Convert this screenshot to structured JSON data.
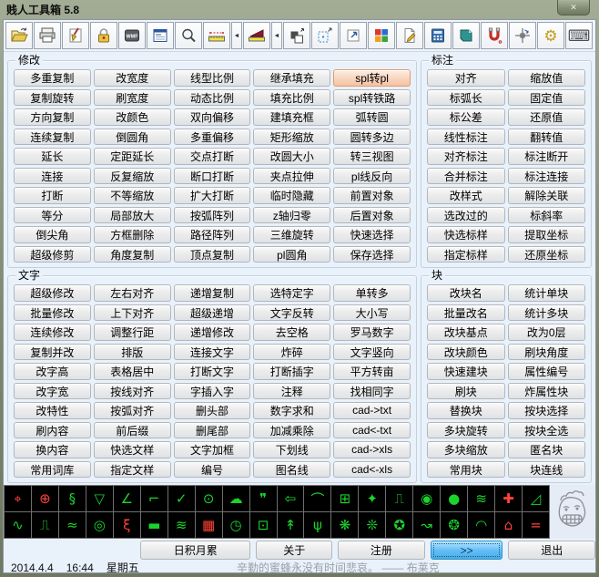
{
  "window": {
    "title": "贱人工具箱 5.8",
    "close_glyph": "✕"
  },
  "toolbar": {
    "wmf_label": "WMF",
    "dropdown_glyph": "◄",
    "items": [
      "open-file",
      "print",
      "purge",
      "lock",
      "wmf-export",
      "form-table",
      "zoom-view",
      "measure",
      "area-fill",
      "copy-objects",
      "stretch-selection",
      "export-window",
      "color-palette",
      "edit-document",
      "calculator",
      "notebook",
      "magnet-osnap",
      "rotate-point",
      "settings-gears",
      "keyboard-shortcuts"
    ]
  },
  "sections": {
    "modify": {
      "title": "修改",
      "highlight": "spl转pl",
      "columns": [
        [
          "多重复制",
          "复制旋转",
          "方向复制",
          "连续复制",
          "延长",
          "连接",
          "打断",
          "等分",
          "倒尖角",
          "超级修剪"
        ],
        [
          "改宽度",
          "刷宽度",
          "改颜色",
          "倒圆角",
          "定距延长",
          "反复缩放",
          "不等缩放",
          "局部放大",
          "方框删除",
          "角度复制"
        ],
        [
          "线型比例",
          "动态比例",
          "双向偏移",
          "多重偏移",
          "交点打断",
          "断口打断",
          "扩大打断",
          "按弧阵列",
          "路径阵列",
          "顶点复制"
        ],
        [
          "继承填充",
          "填充比例",
          "建填充框",
          "矩形缩放",
          "改圆大小",
          "夹点拉伸",
          "临时隐藏",
          "z轴归零",
          "三维旋转",
          "pl圆角"
        ],
        [
          "spl转pl",
          "spl转铁路",
          "弧转圆",
          "圆转多边",
          "转三视图",
          "pl线反向",
          "前置对象",
          "后置对象",
          "快速选择",
          "保存选择"
        ]
      ]
    },
    "dimension": {
      "title": "标注",
      "columns": [
        [
          "对齐",
          "标弧长",
          "标公差",
          "线性标注",
          "对齐标注",
          "合并标注",
          "改样式",
          "选改过的",
          "快选标样",
          "指定标样"
        ],
        [
          "缩放值",
          "固定值",
          "还原值",
          "翻转值",
          "标注断开",
          "标注连接",
          "解除关联",
          "标斜率",
          "提取坐标",
          "还原坐标"
        ]
      ]
    },
    "text": {
      "title": "文字",
      "columns": [
        [
          "超级修改",
          "批量修改",
          "连续修改",
          "复制并改",
          "改字高",
          "改字宽",
          "改特性",
          "刷内容",
          "换内容",
          "常用词库"
        ],
        [
          "左右对齐",
          "上下对齐",
          "调整行距",
          "排版",
          "表格居中",
          "按线对齐",
          "按弧对齐",
          "前后缀",
          "快选文样",
          "指定文样"
        ],
        [
          "递增复制",
          "超级递增",
          "递增修改",
          "连接文字",
          "打断文字",
          "字插入字",
          "删头部",
          "删尾部",
          "文字加框",
          "编号"
        ],
        [
          "选特定字",
          "文字反转",
          "去空格",
          "炸碎",
          "打断插字",
          "注释",
          "数字求和",
          "加减乘除",
          "下划线",
          "图名线"
        ],
        [
          "单转多",
          "大小写",
          "罗马数字",
          "文字竖向",
          "平方转亩",
          "找相同字",
          "cad->txt",
          "cad<-txt",
          "cad->xls",
          "cad<-xls"
        ]
      ]
    },
    "block": {
      "title": "块",
      "columns": [
        [
          "改块名",
          "批量改名",
          "改块基点",
          "改块颜色",
          "快速建块",
          "刷块",
          "替换块",
          "多块旋转",
          "多块缩放",
          "常用块"
        ],
        [
          "统计单块",
          "统计多块",
          "改为0层",
          "刷块角度",
          "属性编号",
          "炸属性块",
          "按块选择",
          "按块全选",
          "匿名块",
          "块连线"
        ]
      ]
    }
  },
  "icon_grid": {
    "rows": [
      [
        {
          "n": "point-cross-square",
          "g": "⌖",
          "c": "r"
        },
        {
          "n": "point-cross-circle",
          "g": "⊕",
          "c": "r"
        },
        {
          "n": "section-symbol",
          "g": "§",
          "c": "g"
        },
        {
          "n": "roughness-symbol",
          "g": "▽",
          "c": "g"
        },
        {
          "n": "slope-symbol",
          "g": "∠",
          "c": "g"
        },
        {
          "n": "corner-dimension",
          "g": "⌐",
          "c": "g"
        },
        {
          "n": "welding-symbol",
          "g": "✓",
          "c": "g"
        },
        {
          "n": "survey-marker",
          "g": "⊙",
          "c": "g"
        },
        {
          "n": "revision-cloud",
          "g": "☁",
          "c": "g"
        },
        {
          "n": "callout-bubble",
          "g": "❞",
          "c": "g"
        },
        {
          "n": "big-left-arrow",
          "g": "⇦",
          "c": "g"
        },
        {
          "n": "curve-chart",
          "g": "⌒",
          "c": "g"
        },
        {
          "n": "table-grid",
          "g": "⊞",
          "c": "g"
        },
        {
          "n": "four-point-star",
          "g": "✦",
          "c": "g"
        },
        {
          "n": "stair-step",
          "g": "⎍",
          "c": "g"
        },
        {
          "n": "circle-instrument",
          "g": "◉",
          "c": "g"
        },
        {
          "n": "filled-dot",
          "g": "●",
          "c": "g"
        },
        {
          "n": "coil-loops",
          "g": "≋",
          "c": "g"
        },
        {
          "n": "red-cross",
          "g": "✚",
          "c": "r"
        },
        {
          "n": "diagonal-chart",
          "g": "◿",
          "c": "g"
        }
      ],
      [
        {
          "n": "sine-wave",
          "g": "∿",
          "c": "g"
        },
        {
          "n": "square-wave",
          "g": "⎍",
          "c": "g"
        },
        {
          "n": "small-zigzag",
          "g": "≈",
          "c": "g"
        },
        {
          "n": "concentric-circles",
          "g": "◎",
          "c": "g"
        },
        {
          "n": "pipe-bend",
          "g": "ξ",
          "c": "r"
        },
        {
          "n": "thick-line",
          "g": "▬",
          "c": "g"
        },
        {
          "n": "spring-coil",
          "g": "≋",
          "c": "g"
        },
        {
          "n": "hatched-square",
          "g": "▦",
          "c": "r"
        },
        {
          "n": "clock",
          "g": "◷",
          "c": "g"
        },
        {
          "n": "box-with-plus",
          "g": "⊡",
          "c": "g"
        },
        {
          "n": "tree-branch",
          "g": "↟",
          "c": "g"
        },
        {
          "n": "grass",
          "g": "ψ",
          "c": "g"
        },
        {
          "n": "gear-outline-1",
          "g": "❋",
          "c": "g"
        },
        {
          "n": "gear-outline-2",
          "g": "❊",
          "c": "g"
        },
        {
          "n": "star-in-circle",
          "g": "✪",
          "c": "g"
        },
        {
          "n": "step-arrow",
          "g": "↝",
          "c": "g"
        },
        {
          "n": "spiral",
          "g": "❂",
          "c": "g"
        },
        {
          "n": "arc-with-points",
          "g": "◠",
          "c": "g"
        },
        {
          "n": "roof-arrow",
          "g": "⌂",
          "c": "r"
        },
        {
          "n": "parallel-lines",
          "g": "=",
          "c": "r"
        }
      ]
    ]
  },
  "footer": {
    "buttons": [
      {
        "name": "daily-tips-button",
        "label": "日积月累"
      },
      {
        "name": "about-button",
        "label": "关于"
      },
      {
        "name": "register-button",
        "label": "注册"
      },
      {
        "name": "more-button",
        "label": ">>",
        "primary": true
      },
      {
        "name": "exit-button",
        "label": "退出"
      }
    ]
  },
  "statusbar": {
    "date": "2014.4.4",
    "time": "16:44",
    "weekday": "星期五",
    "quote": "辛勤的蜜蜂永没有时间悲哀。 —— 布莱克"
  }
}
